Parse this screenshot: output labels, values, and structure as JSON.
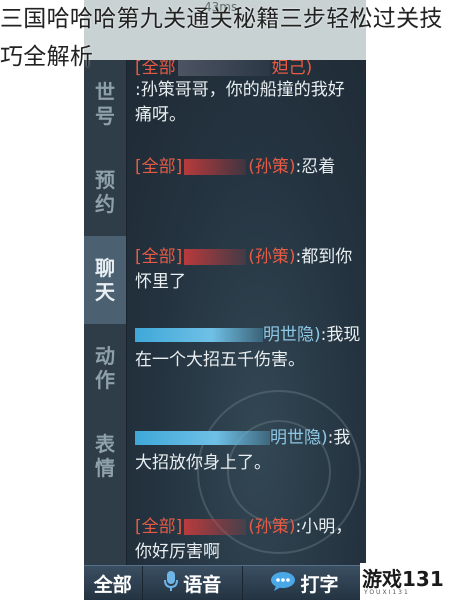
{
  "article": {
    "title": "三国哈哈哈第九关通关秘籍三步轻松过关技巧全解析"
  },
  "status_bar": {
    "text": "43ms"
  },
  "sidebar": {
    "tabs": [
      {
        "label": "世\n号",
        "active": false
      },
      {
        "label": "预\n约",
        "active": false
      },
      {
        "label": "聊\n天",
        "active": true
      },
      {
        "label": "动\n作",
        "active": false
      },
      {
        "label": "表\n情",
        "active": false
      }
    ]
  },
  "chat": {
    "top_partial": {
      "channel": "[全部",
      "name": "妲己)"
    },
    "messages": [
      {
        "channel": "",
        "name": "",
        "text": ":孙策哥哥，你的船撞的我好痛呀。"
      },
      {
        "channel": "[全部]",
        "name": "(孙策)",
        "text": ":忍着"
      },
      {
        "channel": "[全部]",
        "name": "(孙策)",
        "text": ":都到你怀里了"
      },
      {
        "channel": "",
        "name": "明世隐)",
        "text": ":我现在一个大招五千伤害。"
      },
      {
        "channel": "",
        "name": "明世隐)",
        "text": ":我大招放你身上了。"
      },
      {
        "channel": "[全部]",
        "name": "(孙策)",
        "text": ":小明，你好厉害啊"
      }
    ]
  },
  "bottom_bar": {
    "all_label": "全部",
    "voice_label": "语音",
    "type_label": "打字"
  },
  "watermark": {
    "brand": "游戏131",
    "sub": "YOUXI131"
  },
  "colors": {
    "channel_red": "#e85a44",
    "name_blue": "#8cc8e6",
    "panel_bg": "#27343f"
  }
}
